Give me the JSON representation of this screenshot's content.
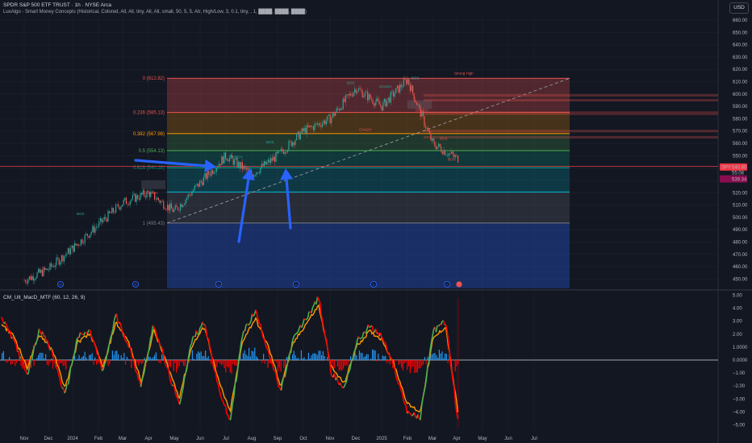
{
  "header": {
    "title": "SPDR S&P 500 ETF TRUST · 1h · NYSE Arca",
    "indicator": "LuxAlgo - Smart Money Concepts (Historical, Colored, All, All, tiny, All, All, small, 50, 5, 5, Atr, High/Low, 3, 0.1, tiny, , 1, ████, ████, ████)",
    "subpane_title": "CM_Ult_MacD_MTF (60, 12, 26, 9)",
    "currency": "USD"
  },
  "colors": {
    "background": "#131722",
    "grid": "#1e222d",
    "up": "#26a69a",
    "down": "#ef5350",
    "arrows": "#2962ff",
    "fib_0": "#ef5350",
    "fib_0236": "#ef5350",
    "fib_0382": "#ff9800",
    "fib_05": "#4caf50",
    "fib_0618": "#089981",
    "fib_0786": "#00bcd4",
    "fib_1": "#787b86",
    "macd_up": "#4caf50",
    "macd_down": "#ff0000",
    "signal": "#ff9800",
    "hist_up": "#2196f3",
    "hist_down": "#ff0000"
  },
  "chart_data": [
    {
      "type": "line",
      "title": "SPDR S&P 500 ETF TRUST · 1h · NYSE Arca",
      "ylim": [
        445,
        665
      ],
      "y_ticks": [
        450,
        460,
        470,
        480,
        490,
        500,
        510,
        520,
        530,
        540,
        550,
        560,
        570,
        580,
        590,
        600,
        610,
        620,
        630,
        640,
        650,
        660
      ],
      "y_tick_labels": [
        "450.00",
        "460.00",
        "470.00",
        "480.00",
        "490.00",
        "500.00",
        "510.00",
        "520.00",
        "530.00",
        "540.00",
        "550.00",
        "560.00",
        "570.00",
        "580.00",
        "590.00",
        "600.00",
        "610.00",
        "620.00",
        "630.00",
        "640.00",
        "650.00",
        "660.00"
      ],
      "x_ticks": [
        "Nov",
        "Dec",
        "2024",
        "Feb",
        "Mar",
        "Apr",
        "May",
        "Jun",
        "Jul",
        "Aug",
        "Sep",
        "Oct",
        "Nov",
        "Dec",
        "2025",
        "Feb",
        "Mar",
        "Apr",
        "May",
        "Jun",
        "Jul"
      ],
      "series": [
        {
          "x": [
            "Nov",
            "Dec",
            "2024",
            "Feb",
            "Mar",
            "Apr",
            "May",
            "Jun",
            "Jul",
            "Aug",
            "Sep",
            "Oct",
            "Nov",
            "Dec",
            "2025",
            "Feb",
            "Mar",
            "Apr"
          ],
          "values": [
            449,
            458,
            475,
            494,
            512,
            520,
            505,
            528,
            550,
            535,
            550,
            570,
            580,
            605,
            590,
            612,
            560,
            548
          ]
        }
      ],
      "fib_levels": [
        {
          "ratio": "0",
          "price": 612.82,
          "label": "0 (612.82)"
        },
        {
          "ratio": "0.236",
          "price": 585.13,
          "label": "0.236 (585.13)"
        },
        {
          "ratio": "0.382",
          "price": 567.98,
          "label": "0.382 (567.98)"
        },
        {
          "ratio": "0.5",
          "price": 554.13,
          "label": "0.5 (554.13)"
        },
        {
          "ratio": "0.618",
          "price": 540.28,
          "label": "0.618 (540.28)"
        },
        {
          "ratio": "0.786",
          "price": 520.58,
          "label": ""
        },
        {
          "ratio": "1",
          "price": 495.43,
          "label": "1 (495.43)"
        }
      ],
      "trend_line": {
        "from": [
          495.43,
          "May"
        ],
        "to": [
          612.82,
          "Jun 2025"
        ]
      },
      "price_badges": [
        {
          "text": "SPY",
          "value": 540.8,
          "label": "540.80"
        },
        {
          "text": "",
          "value": 539.34,
          "label": "539.34"
        }
      ],
      "badge_extra": "55:08",
      "annotations": [
        "CHoCH",
        "BOS",
        "CHoCH",
        "BOS",
        "CHoCH",
        "BOS",
        "CHoCH",
        "BOS",
        "CHoCH",
        "BOS",
        "BOS",
        "Strong High"
      ],
      "events": [
        "D",
        "D",
        "D",
        "D",
        "D",
        "D"
      ]
    },
    {
      "type": "line",
      "title": "CM_Ult_MacD_MTF (60, 12, 26, 9)",
      "ylim": [
        -5.6,
        5.3
      ],
      "y_ticks": [
        5,
        4,
        3,
        2,
        1,
        0,
        -1,
        -2,
        -3,
        -4,
        -5
      ],
      "y_tick_labels": [
        "5.00",
        "4.00",
        "3.00",
        "2.00",
        "1.0000",
        "0.0000",
        "−1.00",
        "−2.00",
        "−3.00",
        "−4.00",
        "−5.00"
      ],
      "zero_label": "0.0000",
      "series": [
        {
          "name": "MACD",
          "values": [
            3.2,
            1.5,
            -1.2,
            2.5,
            0.5,
            -2.8,
            1.8,
            2.2,
            -1.0,
            3.5,
            1.2,
            -2.0,
            2.8,
            -0.5,
            -3.5,
            1.5,
            3.0,
            -1.8,
            -4.8,
            2.0,
            3.8,
            0.8,
            -2.5,
            1.6,
            3.2,
            4.8,
            -1.0,
            -2.2,
            1.4,
            2.6,
            1.8,
            -0.8,
            -4.0,
            -4.5,
            2.2,
            3.0,
            -5.0
          ]
        },
        {
          "name": "Signal",
          "values": [
            2.8,
            1.8,
            -0.6,
            2.0,
            0.8,
            -2.2,
            1.4,
            2.0,
            -0.6,
            2.9,
            1.4,
            -1.6,
            2.3,
            -0.2,
            -2.9,
            1.1,
            2.6,
            -1.3,
            -4.0,
            1.5,
            3.2,
            1.1,
            -2.0,
            1.3,
            2.8,
            4.2,
            -0.6,
            -1.8,
            1.1,
            2.2,
            1.6,
            -0.5,
            -3.4,
            -4.0,
            1.6,
            2.6,
            -4.2
          ]
        }
      ]
    }
  ]
}
